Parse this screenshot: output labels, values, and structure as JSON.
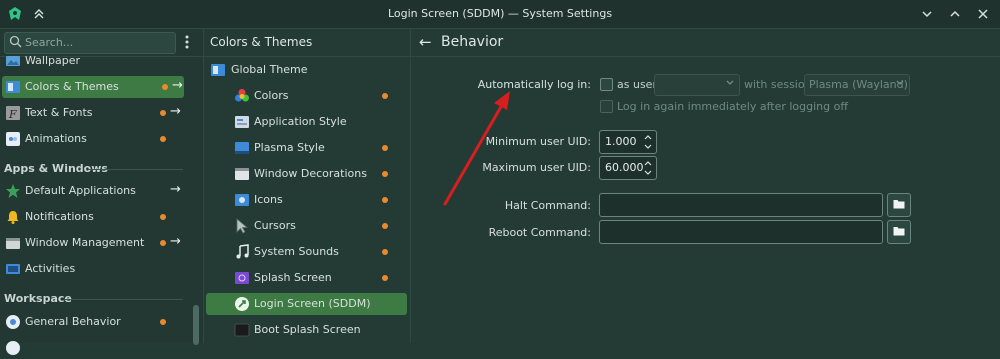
{
  "window": {
    "title": "Login Screen (SDDM) — System Settings"
  },
  "search": {
    "placeholder": "Search..."
  },
  "sidebar": {
    "items": [
      {
        "label": "Wallpaper",
        "icon": "wallpaper-icon"
      },
      {
        "label": "Colors & Themes",
        "icon": "colors-themes-icon"
      },
      {
        "label": "Text & Fonts",
        "icon": "font-icon"
      },
      {
        "label": "Animations",
        "icon": "animations-icon"
      }
    ],
    "section_apps": "Apps & Windows",
    "apps_items": [
      {
        "label": "Default Applications",
        "icon": "star-icon"
      },
      {
        "label": "Notifications",
        "icon": "bell-icon"
      },
      {
        "label": "Window Management",
        "icon": "window-management-icon"
      },
      {
        "label": "Activities",
        "icon": "activities-icon"
      }
    ],
    "section_workspace": "Workspace",
    "workspace_items": [
      {
        "label": "General Behavior",
        "icon": "general-behavior-icon"
      }
    ]
  },
  "subnav": {
    "header": "Colors & Themes",
    "items": [
      {
        "label": "Global Theme",
        "icon": "global-theme-icon"
      },
      {
        "label": "Colors",
        "icon": "colors-icon"
      },
      {
        "label": "Application Style",
        "icon": "application-style-icon"
      },
      {
        "label": "Plasma Style",
        "icon": "plasma-style-icon"
      },
      {
        "label": "Window Decorations",
        "icon": "window-decorations-icon"
      },
      {
        "label": "Icons",
        "icon": "icons-icon"
      },
      {
        "label": "Cursors",
        "icon": "cursor-icon"
      },
      {
        "label": "System Sounds",
        "icon": "music-note-icon"
      },
      {
        "label": "Splash Screen",
        "icon": "splash-screen-icon"
      },
      {
        "label": "Login Screen (SDDM)",
        "icon": "login-screen-icon"
      },
      {
        "label": "Boot Splash Screen",
        "icon": "boot-splash-icon"
      }
    ]
  },
  "main": {
    "header": "Behavior",
    "autologin_label": "Automatically log in:",
    "as_user_label": "as user:",
    "user_value": "",
    "with_session_label": "with session",
    "session_value": "Plasma (Wayland)",
    "relogin_label": "Log in again immediately after logging off",
    "min_uid_label": "Minimum user UID:",
    "min_uid_value": "1.000",
    "max_uid_label": "Maximum user UID:",
    "max_uid_value": "60.000",
    "halt_label": "Halt Command:",
    "halt_value": "",
    "reboot_label": "Reboot Command:",
    "reboot_value": ""
  },
  "colors": {
    "accent_selected": "#3e7a43",
    "indicator_dot": "#e98a2e",
    "annotation_arrow": "#d81e1e"
  }
}
